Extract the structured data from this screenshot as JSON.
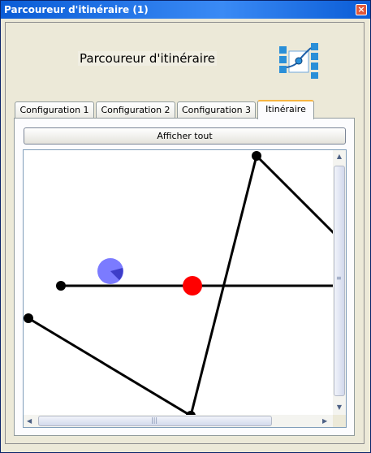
{
  "window": {
    "title": "Parcoureur d'itinéraire (1)",
    "close_icon": "close-icon"
  },
  "header": {
    "title": "Parcoureur d'itinéraire",
    "logo_icon": "route-logo-icon"
  },
  "tabs": [
    {
      "label": "Configuration 1",
      "active": false
    },
    {
      "label": "Configuration 2",
      "active": false
    },
    {
      "label": "Configuration 3",
      "active": false
    },
    {
      "label": "Itinéraire",
      "active": true
    }
  ],
  "toolbar": {
    "show_all_label": "Afficher tout"
  },
  "route_view": {
    "path_color": "#000000",
    "waypoint_color": "#000000",
    "current_position_color": "#ff0000",
    "orientation_marker_color": "#7b7bff"
  },
  "colors": {
    "titlebar": "#0a5cd6",
    "active_tab_accent": "#f6b542"
  }
}
